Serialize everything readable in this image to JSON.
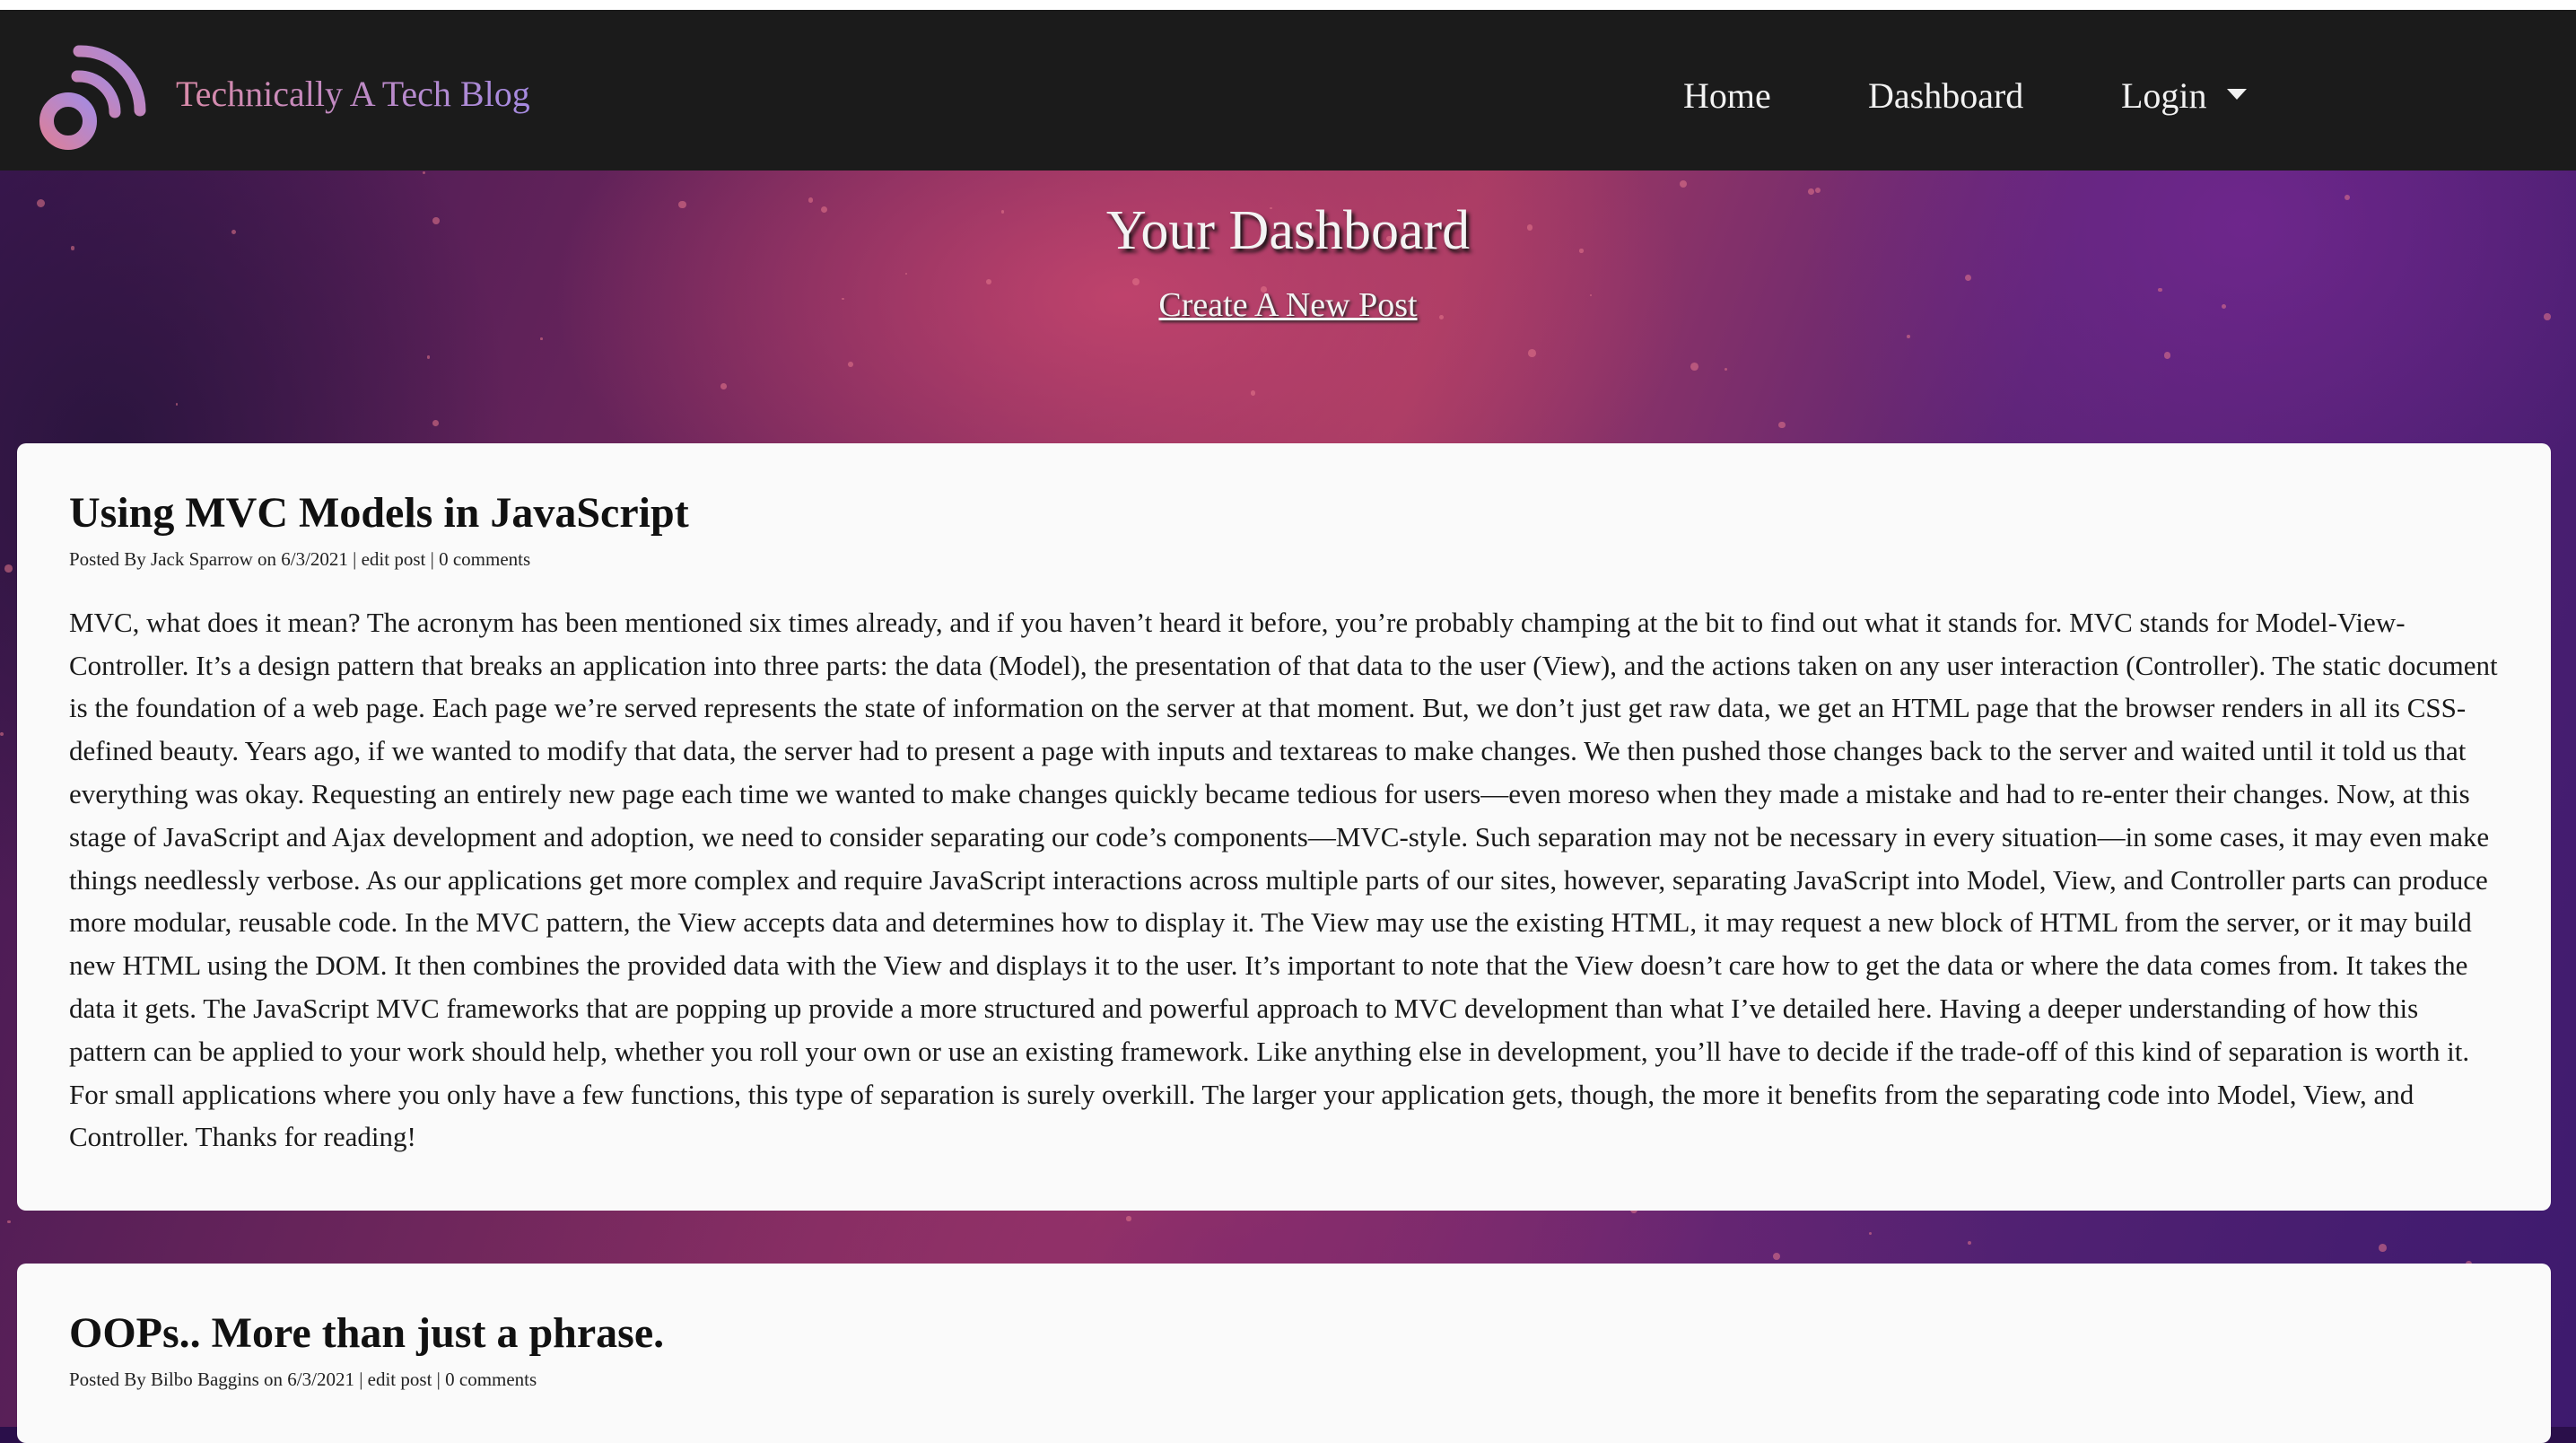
{
  "header": {
    "brand": "Technically A Tech Blog",
    "nav": {
      "home": "Home",
      "dashboard": "Dashboard",
      "login": "Login"
    }
  },
  "dashboard": {
    "title": "Your Dashboard",
    "create_link": "Create A New Post"
  },
  "posts": [
    {
      "title": "Using MVC Models in JavaScript",
      "meta_prefix": "Posted By Jack Sparrow on 6/3/2021 | ",
      "edit_label": "edit post",
      "separator": " | ",
      "comments_label": "0 comments",
      "body": "MVC, what does it mean? The acronym has been mentioned six times already, and if you haven’t heard it before, you’re probably champing at the bit to find out what it stands for. MVC stands for Model-View-Controller. It’s a design pattern that breaks an application into three parts: the data (Model), the presentation of that data to the user (View), and the actions taken on any user interaction (Controller). The static document is the foundation of a web page. Each page we’re served represents the state of information on the server at that moment. But, we don’t just get raw data, we get an HTML page that the browser renders in all its CSS-defined beauty. Years ago, if we wanted to modify that data, the server had to present a page with inputs and textareas to make changes. We then pushed those changes back to the server and waited until it told us that everything was okay. Requesting an entirely new page each time we wanted to make changes quickly became tedious for users—even moreso when they made a mistake and had to re-enter their changes. Now, at this stage of JavaScript and Ajax development and adoption, we need to consider separating our code’s components—MVC-style. Such separation may not be necessary in every situation—in some cases, it may even make things needlessly verbose. As our applications get more complex and require JavaScript interactions across multiple parts of our sites, however, separating JavaScript into Model, View, and Controller parts can produce more modular, reusable code. In the MVC pattern, the View accepts data and determines how to display it. The View may use the existing HTML, it may request a new block of HTML from the server, or it may build new HTML using the DOM. It then combines the provided data with the View and displays it to the user. It’s important to note that the View doesn’t care how to get the data or where the data comes from. It takes the data it gets. The JavaScript MVC frameworks that are popping up provide a more structured and powerful approach to MVC development than what I’ve detailed here. Having a deeper understanding of how this pattern can be applied to your work should help, whether you roll your own or use an existing framework. Like anything else in development, you’ll have to decide if the trade-off of this kind of separation is worth it. For small applications where you only have a few functions, this type of separation is surely overkill. The larger your application gets, though, the more it benefits from the separating code into Model, View, and Controller. Thanks for reading!"
    },
    {
      "title": "OOPs.. More than just a phrase.",
      "meta_prefix": "Posted By Bilbo Baggins on 6/3/2021 | ",
      "edit_label": "edit post",
      "separator": " | ",
      "comments_label": "0 comments"
    }
  ],
  "colors": {
    "topbar_bg": "#1b1b1b",
    "card_bg": "#fafafa",
    "brand_gradient_start": "#d98aa8",
    "brand_gradient_end": "#a58ae0"
  },
  "icons": {
    "logo": "wifi-b-logo-icon",
    "login_caret": "caret-down-icon"
  }
}
